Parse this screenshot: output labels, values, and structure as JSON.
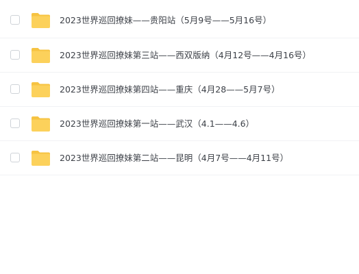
{
  "files": [
    {
      "name": "2023世界巡回撩妹——贵阳站（5月9号——5月16号）",
      "icon": "folder-icon"
    },
    {
      "name": "2023世界巡回撩妹第三站——西双版纳（4月12号——4月16号）",
      "icon": "folder-icon"
    },
    {
      "name": "2023世界巡回撩妹第四站——重庆（4月28——5月7号）",
      "icon": "folder-icon"
    },
    {
      "name": "2023世界巡回撩妹第一站——武汉（4.1——4.6）",
      "icon": "folder-icon"
    },
    {
      "name": "2023世界巡回撩妹第二站——昆明（4月7号——4月11号）",
      "icon": "folder-icon"
    }
  ],
  "colors": {
    "folder": "#fcd15b",
    "folder_tab": "#f6c342",
    "text": "#3b3f46",
    "divider": "#f1f2f4"
  }
}
